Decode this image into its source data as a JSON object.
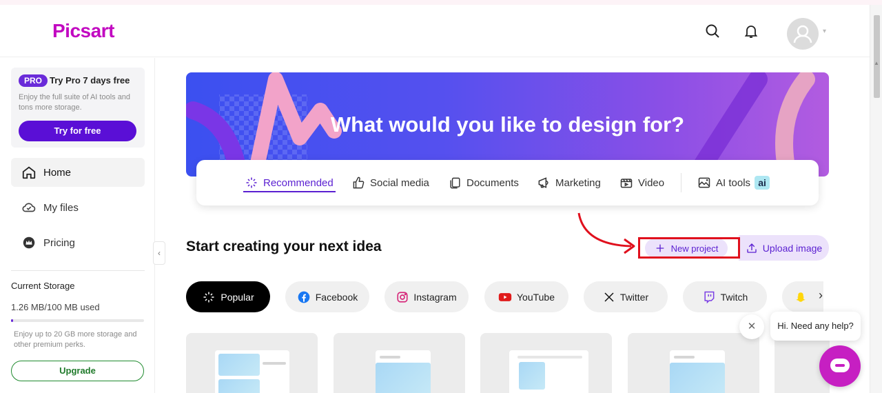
{
  "header": {
    "logo": "Picsart",
    "icons": [
      "search-icon",
      "bell-icon",
      "avatar"
    ]
  },
  "sidebar": {
    "pro": {
      "badge": "PRO",
      "title": "Try Pro 7 days free",
      "description": "Enjoy the full suite of AI tools and tons more storage.",
      "button": "Try for free"
    },
    "nav": [
      {
        "label": "Home",
        "icon": "home-icon",
        "active": true
      },
      {
        "label": "My files",
        "icon": "cloud-icon",
        "active": false
      },
      {
        "label": "Pricing",
        "icon": "crown-icon",
        "active": false
      }
    ],
    "storage": {
      "title": "Current Storage",
      "used": "1.26 MB/100 MB used",
      "progress": 0.0126,
      "description": "Enjoy up to 20 GB more storage and other premium perks.",
      "button": "Upgrade"
    }
  },
  "banner": {
    "title": "What would you like to design for?"
  },
  "categories": [
    {
      "label": "Recommended",
      "icon": "sparkle-icon",
      "active": true
    },
    {
      "label": "Social media",
      "icon": "thumbs-up-icon",
      "active": false
    },
    {
      "label": "Documents",
      "icon": "documents-icon",
      "active": false
    },
    {
      "label": "Marketing",
      "icon": "marketing-icon",
      "active": false
    },
    {
      "label": "Video",
      "icon": "video-icon",
      "active": false
    },
    {
      "label": "AI tools",
      "icon": "ai-image-icon",
      "badge": "ai",
      "active": false
    }
  ],
  "main": {
    "section_title": "Start creating your next idea",
    "new_project": "New project",
    "upload_image": "Upload image"
  },
  "chips": [
    {
      "label": "Popular",
      "icon": "sparkle-icon",
      "active": true
    },
    {
      "label": "Facebook",
      "icon": "facebook-icon",
      "active": false
    },
    {
      "label": "Instagram",
      "icon": "instagram-icon",
      "active": false
    },
    {
      "label": "YouTube",
      "icon": "youtube-icon",
      "active": false
    },
    {
      "label": "Twitter",
      "icon": "x-icon",
      "active": false
    },
    {
      "label": "Twitch",
      "icon": "twitch-icon",
      "active": false
    }
  ],
  "help": {
    "bubble": "Hi. Need any help?"
  },
  "colors": {
    "brand": "#c209c1",
    "accent": "#5a1fd1",
    "upgrade": "#1f8a2e",
    "highlight": "#e0101d"
  }
}
